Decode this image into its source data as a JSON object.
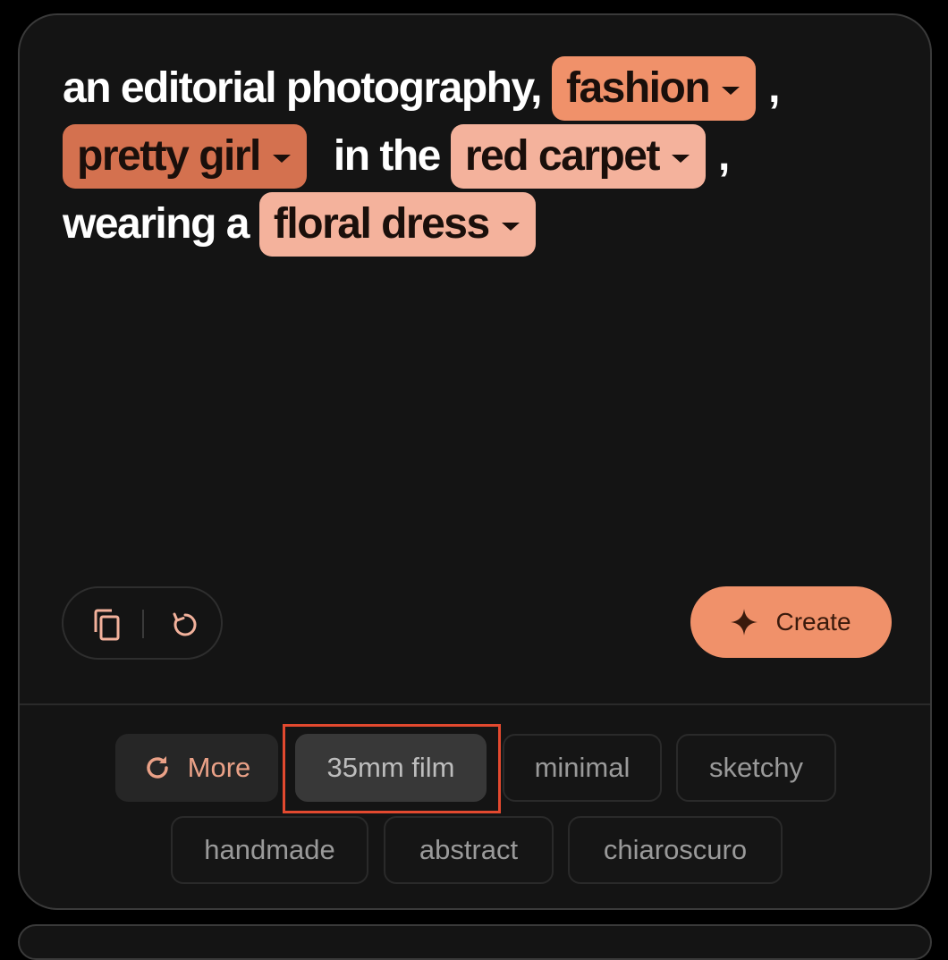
{
  "prompt": {
    "line1_text": "an editorial photography,",
    "line2_text": "in the",
    "line3_text": "wearing a",
    "comma": ",",
    "chips": [
      {
        "label": "fashion",
        "color": "#f0916a"
      },
      {
        "label": "pretty girl",
        "color": "#d4714f"
      },
      {
        "label": "red carpet",
        "color": "#f4b29c"
      },
      {
        "label": "floral dress",
        "color": "#f4b29c"
      }
    ]
  },
  "actions": {
    "copy_icon": "copy-icon",
    "reset_icon": "reset-icon",
    "create_label": "Create",
    "create_icon": "sparkle-icon",
    "create_color": "#f0916a"
  },
  "styles": {
    "more_label": "More",
    "more_icon": "refresh-icon",
    "selected": "35mm film",
    "chips": [
      "35mm film",
      "minimal",
      "sketchy",
      "handmade",
      "abstract",
      "chiaroscuro"
    ]
  }
}
